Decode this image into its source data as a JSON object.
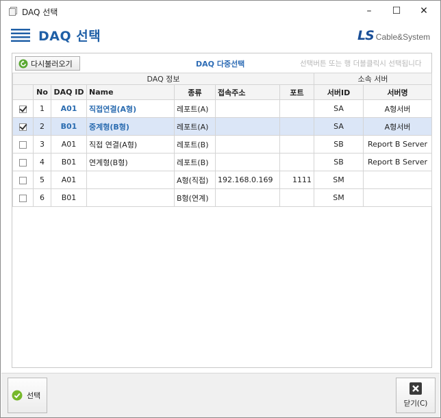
{
  "window": {
    "title": "DAQ 선택",
    "minimize": "–",
    "maximize": "☐",
    "close": "✕"
  },
  "header": {
    "title": "DAQ 선택",
    "logo_main": "LS",
    "logo_sub": "Cable&System"
  },
  "toolbar": {
    "reload_label": "다시불러오기",
    "multi_title": "DAQ 다중선택",
    "hint": "선택버튼 또는 행 더블클릭시 선택됩니다"
  },
  "table": {
    "group_daq": "DAQ 정보",
    "group_server": "소속 서버",
    "columns": {
      "no": "No",
      "daq_id": "DAQ ID",
      "name": "Name",
      "type": "종류",
      "address": "접속주소",
      "port": "포트",
      "server_id": "서버ID",
      "server_name": "서버명"
    },
    "rows": [
      {
        "checked": true,
        "no": "1",
        "daq_id": "A01",
        "name": "직접연결(A형)",
        "type": "레포트(A)",
        "address": "",
        "port": "",
        "server_id": "SA",
        "server_name": "A형서버",
        "highlight": true
      },
      {
        "checked": true,
        "no": "2",
        "daq_id": "B01",
        "name": "중계형(B형)",
        "type": "레포트(A)",
        "address": "",
        "port": "",
        "server_id": "SA",
        "server_name": "A형서버",
        "highlight": true
      },
      {
        "checked": false,
        "no": "3",
        "daq_id": "A01",
        "name": "직접 연결(A형)",
        "type": "레포트(B)",
        "address": "",
        "port": "",
        "server_id": "SB",
        "server_name": "Report B Server",
        "highlight": false
      },
      {
        "checked": false,
        "no": "4",
        "daq_id": "B01",
        "name": "연계형(B형)",
        "type": "레포트(B)",
        "address": "",
        "port": "",
        "server_id": "SB",
        "server_name": "Report B Server",
        "highlight": false
      },
      {
        "checked": false,
        "no": "5",
        "daq_id": "A01",
        "name": "",
        "type": "A형(직접)",
        "address": "192.168.0.169",
        "port": "1111",
        "server_id": "SM",
        "server_name": "",
        "highlight": false
      },
      {
        "checked": false,
        "no": "6",
        "daq_id": "B01",
        "name": "",
        "type": "B형(연계)",
        "address": "",
        "port": "",
        "server_id": "SM",
        "server_name": "",
        "highlight": false
      }
    ]
  },
  "footer": {
    "select_label": "선택",
    "close_label": "닫기(C)"
  },
  "colors": {
    "accent": "#1f5fa6",
    "selected_row": "#dbe6f7",
    "highlight_text": "#2b6cb0"
  }
}
